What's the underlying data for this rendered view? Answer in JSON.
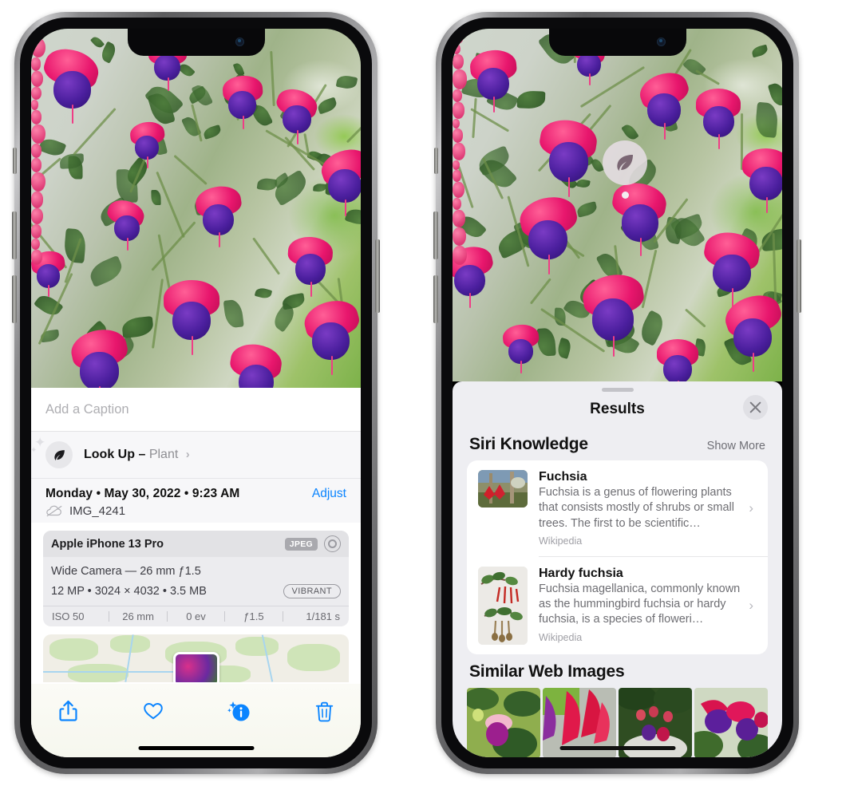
{
  "left_phone": {
    "name": "Photos app — photo info view",
    "caption": {
      "placeholder": "Add a Caption",
      "value": ""
    },
    "lookup": {
      "label": "Look Up",
      "dash": "–",
      "subject": "Plant",
      "chevron": "›",
      "icon": "leaf-icon"
    },
    "meta": {
      "date": "Monday • May 30, 2022 • 9:23 AM",
      "adjust_label": "Adjust",
      "filename": "IMG_4241",
      "cloud_icon": "cloud-slash-icon"
    },
    "camera_card": {
      "device": "Apple iPhone 13 Pro",
      "format_badge": "JPEG",
      "aperture_icon": "aperture-icon",
      "lens_line": "Wide Camera — 26 mm ƒ1.5",
      "specs_line": "12 MP • 3024 × 4032 • 3.5 MB",
      "profile_badge": "VIBRANT",
      "exif": [
        "ISO 50",
        "26 mm",
        "0 ev",
        "ƒ1.5",
        "1/181 s"
      ]
    },
    "map": {
      "name": "location-map",
      "pin": "photo-thumbnail-pin"
    },
    "toolbar": [
      {
        "name": "share-icon",
        "label": "Share"
      },
      {
        "name": "favorite-heart-icon",
        "label": "Favorite"
      },
      {
        "name": "info-sparkle-icon",
        "label": "Info",
        "active": true
      },
      {
        "name": "trash-icon",
        "label": "Delete"
      }
    ]
  },
  "right_phone": {
    "name": "Photos app — Visual Look Up results",
    "pin_badge": {
      "icon": "leaf-icon",
      "name": "visual-lookup-badge"
    },
    "sheet": {
      "title": "Results",
      "close_icon": "close-x-icon",
      "grabber": "sheet-grabber"
    },
    "siri_knowledge": {
      "section_title": "Siri Knowledge",
      "show_more": "Show More",
      "items": [
        {
          "title": "Fuchsia",
          "description": "Fuchsia is a genus of flowering plants that consists mostly of shrubs or small trees. The first to be scientific…",
          "source": "Wikipedia",
          "chevron": "›"
        },
        {
          "title": "Hardy fuchsia",
          "description": "Fuchsia magellanica, commonly known as the hummingbird fuchsia or hardy fuchsia, is a species of floweri…",
          "source": "Wikipedia",
          "chevron": "›"
        }
      ]
    },
    "similar_web_images": {
      "section_title": "Similar Web Images",
      "thumbs": [
        "fuchsia-thumb-1",
        "fuchsia-thumb-2",
        "fuchsia-thumb-3",
        "fuchsia-thumb-4"
      ]
    }
  },
  "colors": {
    "accent_blue": "#0a84ff",
    "sheet_gray": "#eeeef2",
    "card_white": "#ffffff",
    "secondary_text": "#6e6e73",
    "badge_gray": "#a9a9ae"
  }
}
